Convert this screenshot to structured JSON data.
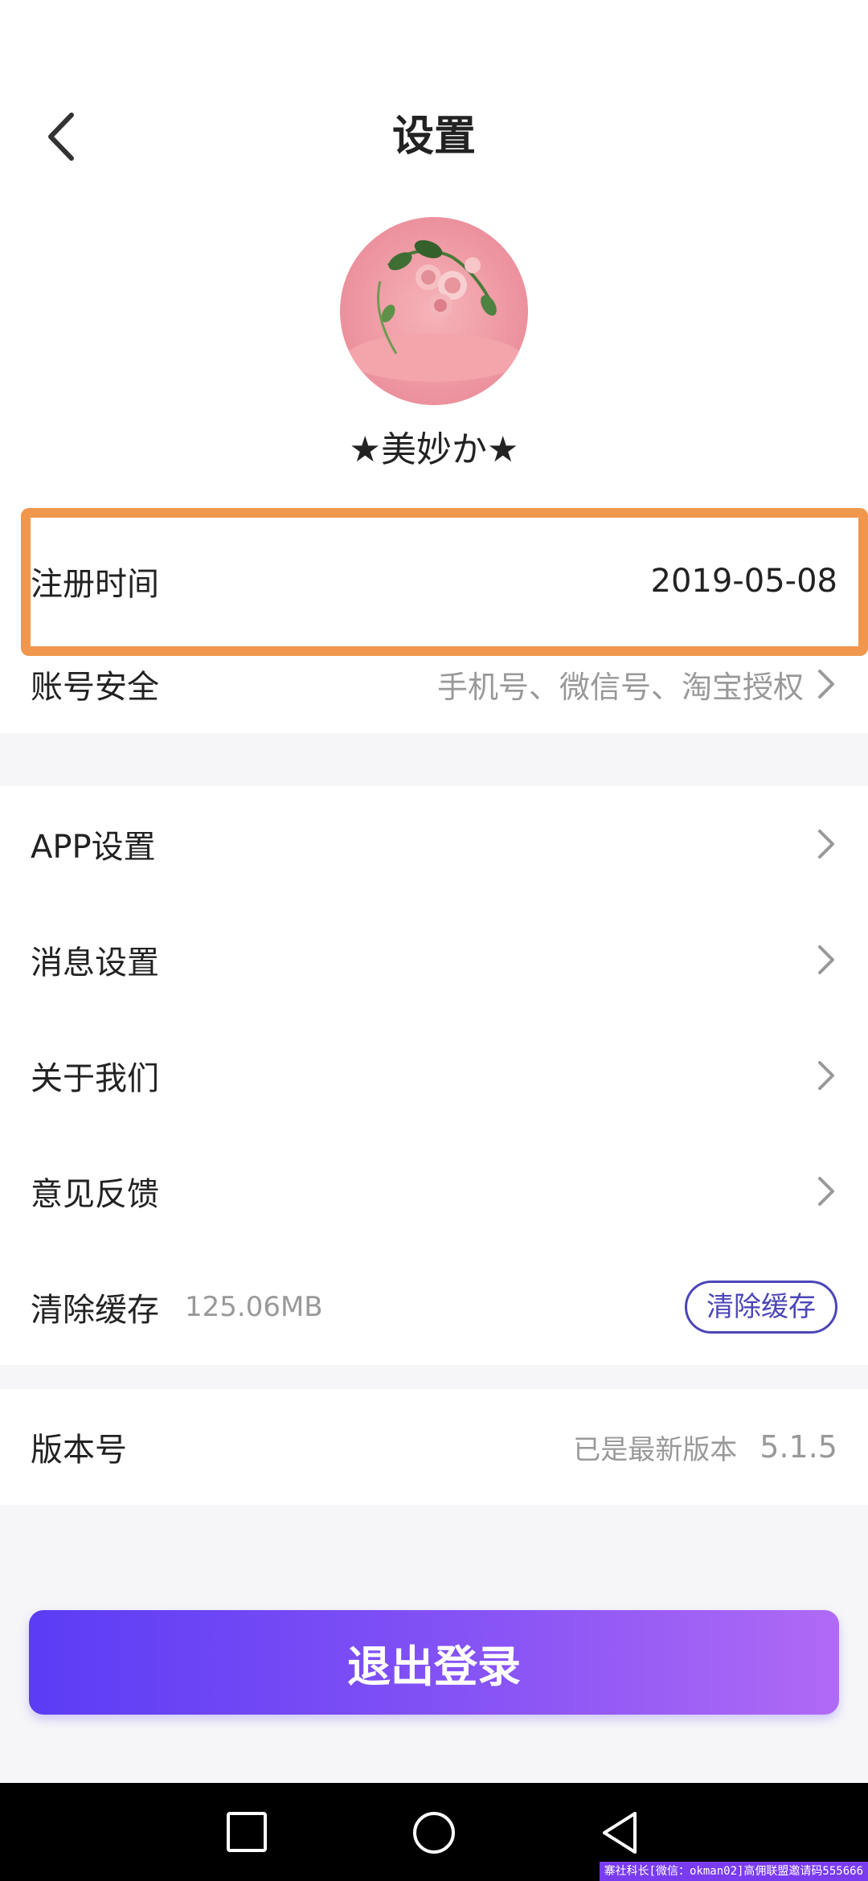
{
  "header": {
    "title": "设置"
  },
  "profile": {
    "nickname": "★美妙か★"
  },
  "rows": {
    "register_time": {
      "label": "注册时间",
      "value": "2019-05-08"
    },
    "account_security": {
      "label": "账号安全",
      "value": "手机号、微信号、淘宝授权"
    },
    "app_settings": {
      "label": "APP设置"
    },
    "message_settings": {
      "label": "消息设置"
    },
    "about_us": {
      "label": "关于我们"
    },
    "feedback": {
      "label": "意见反馈"
    },
    "clear_cache": {
      "label": "清除缓存",
      "size": "125.06MB",
      "button": "清除缓存"
    },
    "version": {
      "label": "版本号",
      "status": "已是最新版本",
      "number": "5.1.5"
    }
  },
  "logout": {
    "label": "退出登录"
  },
  "watermark": "寨社科长[微信：okman02]高佣联盟邀请码555666",
  "icons": {
    "back": "chevron-left-icon",
    "chevron": "chevron-right-icon",
    "nav_recent": "square-icon",
    "nav_home": "circle-icon",
    "nav_back": "triangle-icon"
  },
  "colors": {
    "accent": "#4b46b8",
    "logout_gradient_start": "#5b3cf5",
    "logout_gradient_end": "#b06af5",
    "highlight": "#f0974d"
  }
}
